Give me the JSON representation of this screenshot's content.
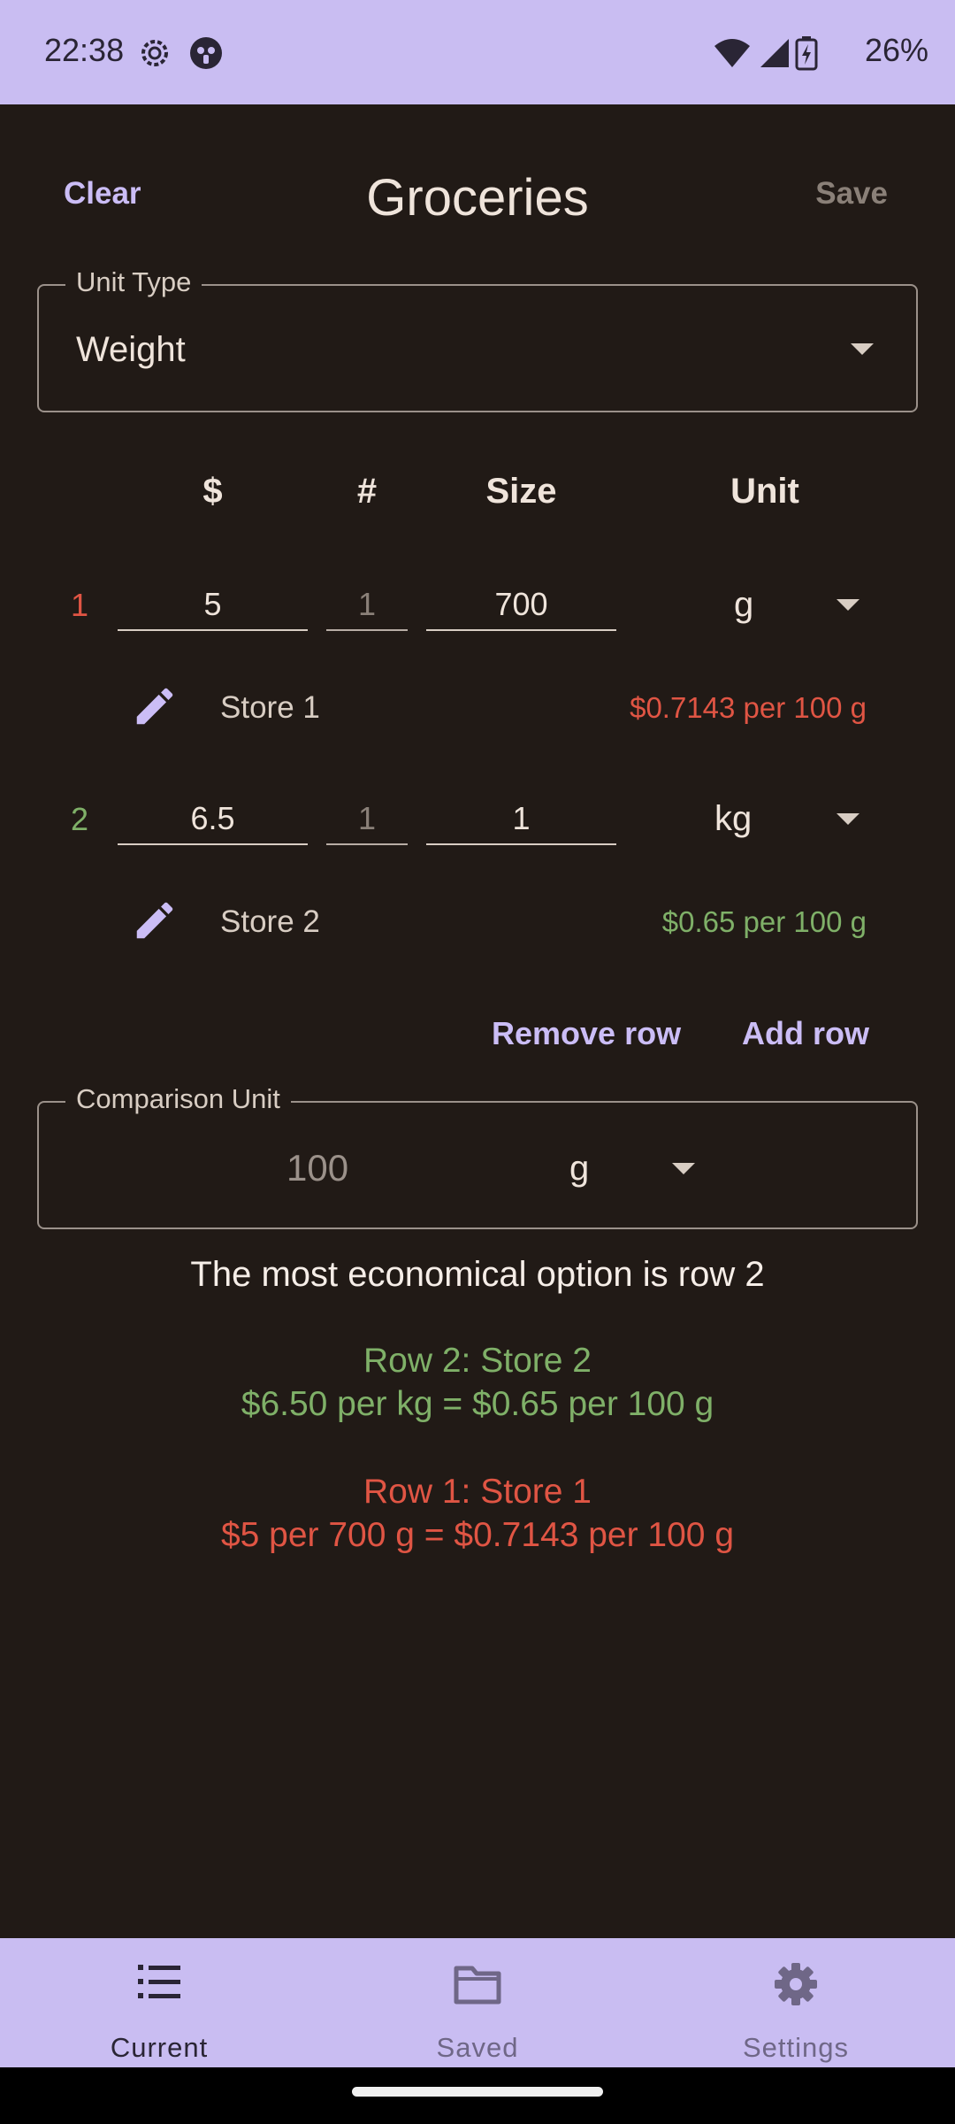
{
  "status_bar": {
    "time": "22:38",
    "battery": "26%"
  },
  "header": {
    "clear_label": "Clear",
    "title": "Groceries",
    "save_label": "Save"
  },
  "unit_type": {
    "label": "Unit Type",
    "value": "Weight"
  },
  "columns": {
    "price": "$",
    "count": "#",
    "size": "Size",
    "unit": "Unit"
  },
  "rows": [
    {
      "number": "1",
      "price": "5",
      "count": "1",
      "size": "700",
      "unit": "g",
      "store": "Store 1",
      "per_unit": "$0.7143 per 100 g",
      "status_color": "#e05544"
    },
    {
      "number": "2",
      "price": "6.5",
      "count": "1",
      "size": "1",
      "unit": "kg",
      "store": "Store 2",
      "per_unit": "$0.65 per 100 g",
      "status_color": "#7fb068"
    }
  ],
  "actions": {
    "remove_row": "Remove row",
    "add_row": "Add row"
  },
  "comparison": {
    "label": "Comparison Unit",
    "amount": "100",
    "unit": "g"
  },
  "results": {
    "headline": "The most economical option is row 2",
    "best": {
      "title": "Row 2: Store 2",
      "detail": "$6.50 per kg = $0.65 per 100 g"
    },
    "other": {
      "title": "Row 1: Store 1",
      "detail": "$5 per 700 g = $0.7143 per 100 g"
    }
  },
  "bottom_nav": [
    {
      "label": "Current",
      "icon": "list-numbered-icon",
      "active": true
    },
    {
      "label": "Saved",
      "icon": "folder-icon",
      "active": false
    },
    {
      "label": "Settings",
      "icon": "gear-icon",
      "active": false
    }
  ],
  "colors": {
    "accent": "#cbbdf6",
    "nav_bg": "#c9bdf2",
    "background": "#211a16",
    "best": "#7fb068",
    "worst": "#e05544"
  }
}
